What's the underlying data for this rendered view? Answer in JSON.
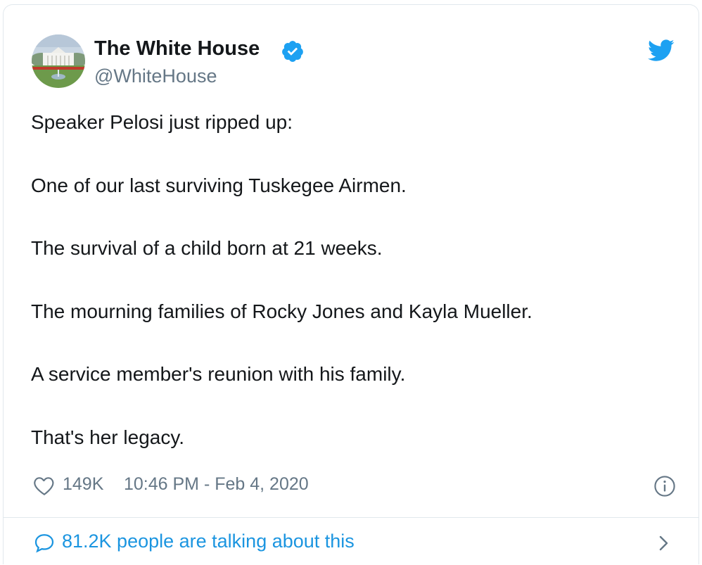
{
  "tweet": {
    "display_name": "The White House",
    "handle": "@WhiteHouse",
    "verified": true,
    "lines": [
      "Speaker Pelosi just ripped up:",
      "One of our last surviving Tuskegee Airmen.",
      "The survival of a child born at 21 weeks.",
      "The mourning families of Rocky Jones and Kayla Mueller.",
      "A service member's reunion with his family.",
      "That's her legacy."
    ],
    "like_count": "149K",
    "timestamp": "10:46 PM - Feb 4, 2020",
    "talking_label": "81.2K people are talking about this"
  },
  "icons": {
    "verified": "verified-badge-icon",
    "brand": "twitter-bird-icon",
    "like": "heart-icon",
    "info": "info-icon",
    "reply": "comment-bubble-icon",
    "next": "chevron-right-icon"
  },
  "colors": {
    "brand_blue": "#1da1f2",
    "link_blue": "#1b95e0",
    "secondary_text": "#657786",
    "primary_text": "#14171a",
    "border": "#e1e8ed"
  }
}
